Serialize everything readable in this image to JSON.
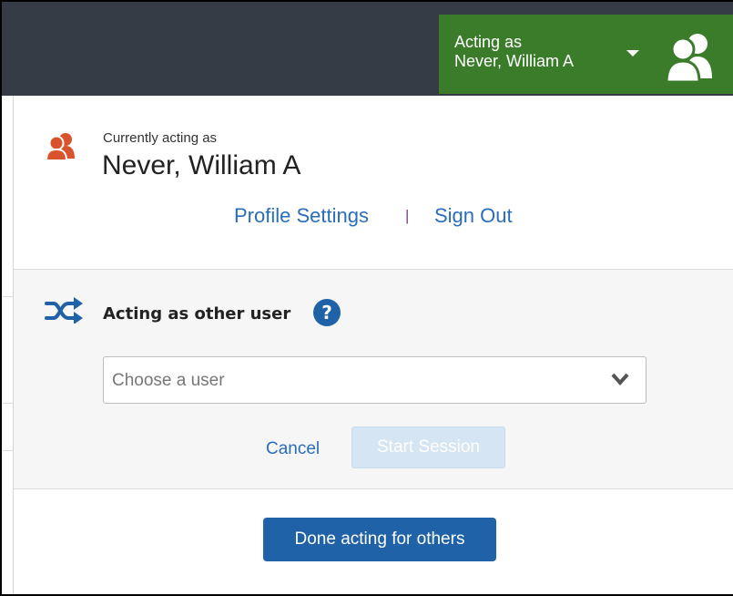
{
  "header": {
    "acting_as_label": "Acting as",
    "acting_user_name": "Never, William A",
    "users_icon": "users-group-icon",
    "caret_icon": "caret-down-icon",
    "badge_color": "#3b7c2a",
    "bar_color": "#353c46"
  },
  "current": {
    "caption": "Currently acting as",
    "name": "Never, William A",
    "icon": "user-group-icon",
    "icon_color": "#d9532c",
    "profile_link": "Profile Settings",
    "separator": "|",
    "signout_link": "Sign Out"
  },
  "act_other": {
    "title": "Acting as other user",
    "shuffle_icon": "shuffle-icon",
    "help_icon": "help-icon",
    "select_placeholder": "Choose a user",
    "cancel_label": "Cancel",
    "start_label": "Start Session"
  },
  "footer": {
    "done_label": "Done acting for others"
  }
}
